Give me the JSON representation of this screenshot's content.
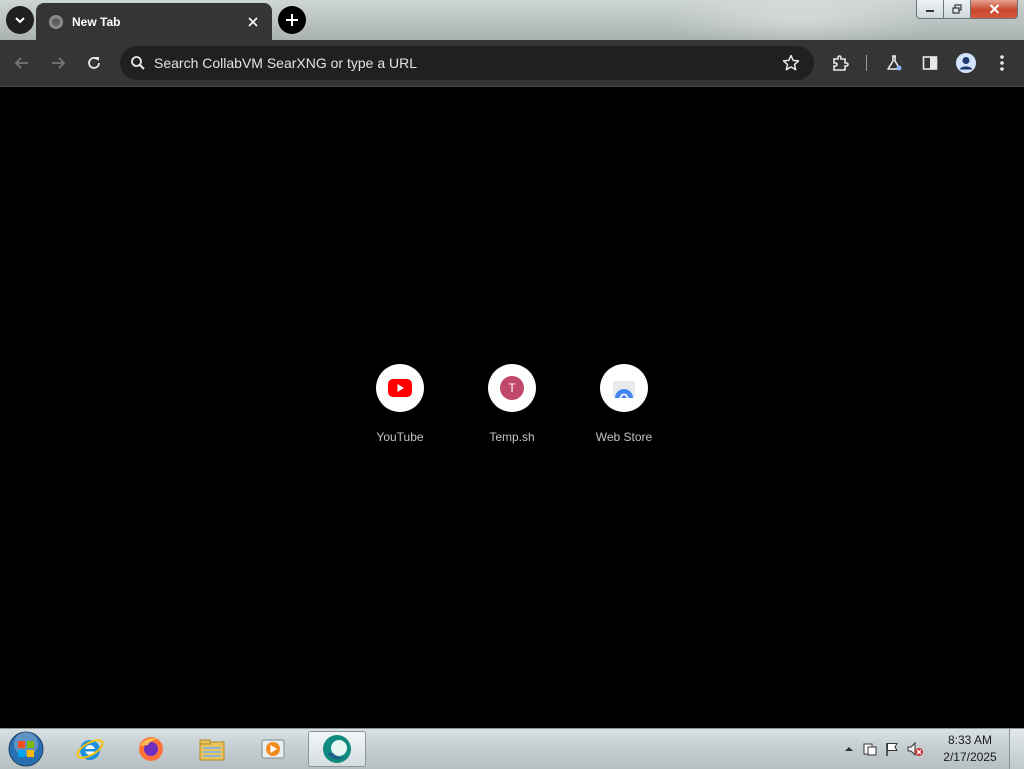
{
  "tab": {
    "title": "New Tab"
  },
  "omnibox": {
    "placeholder": "Search CollabVM SearXNG or type a URL"
  },
  "shortcuts": [
    {
      "label": "YouTube",
      "icon": "youtube-icon"
    },
    {
      "label": "Temp.sh",
      "icon": "letter-t-icon",
      "letter": "T"
    },
    {
      "label": "Web Store",
      "icon": "web-store-icon"
    }
  ],
  "taskbar": {
    "apps": [
      "internet-explorer-icon",
      "firefox-icon",
      "file-explorer-icon",
      "media-player-icon",
      "edge-beta-icon"
    ],
    "clock_time": "8:33 AM",
    "clock_date": "2/17/2025"
  },
  "colors": {
    "toolbar": "#353535",
    "omnibox": "#202020",
    "page": "#000000",
    "youtube_red": "#ff0000",
    "temp_badge": "#c0496b"
  }
}
